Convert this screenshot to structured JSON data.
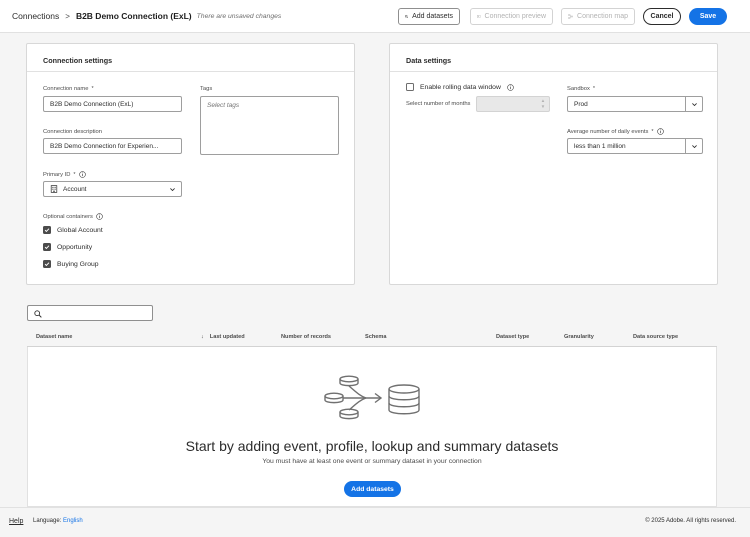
{
  "header": {
    "breadcrumb_root": "Connections",
    "breadcrumb_separator": ">",
    "breadcrumb_current": "B2B Demo Connection (ExL)",
    "unsaved_note": "There are unsaved changes",
    "add_datasets_label": "Add datasets",
    "connection_preview_label": "Connection preview",
    "connection_map_label": "Connection map",
    "cancel_label": "Cancel",
    "save_label": "Save"
  },
  "connection_settings": {
    "title": "Connection settings",
    "name_label": "Connection name",
    "name_value": "B2B Demo Connection (ExL)",
    "tags_label": "Tags",
    "tags_placeholder": "Select tags",
    "description_label": "Connection description",
    "description_value": "B2B Demo Connection for Experien...",
    "primary_id_label": "Primary ID",
    "primary_id_value": "Account",
    "optional_containers_label": "Optional containers",
    "containers": [
      {
        "label": "Global Account",
        "checked": true
      },
      {
        "label": "Opportunity",
        "checked": true
      },
      {
        "label": "Buying Group",
        "checked": true
      }
    ]
  },
  "data_settings": {
    "title": "Data settings",
    "rolling_window_label": "Enable rolling data window",
    "rolling_window_checked": false,
    "months_label": "Select number of months",
    "sandbox_label": "Sandbox",
    "sandbox_value": "Prod",
    "daily_events_label": "Average number of daily events",
    "daily_events_value": "less than 1 million"
  },
  "required_marker": "*",
  "table": {
    "columns": [
      "Dataset name",
      "Last updated",
      "Number of records",
      "Schema",
      "Dataset type",
      "Granularity",
      "Data source type"
    ],
    "sort_indicator": "↓"
  },
  "empty_state": {
    "title": "Start by adding event, profile, lookup and summary datasets",
    "subtitle": "You must have at least one event or summary dataset in your connection",
    "button_label": "Add datasets"
  },
  "footer": {
    "help": "Help",
    "language_label": "Language:",
    "language_value": "English",
    "copyright": "© 2025 Adobe. All rights reserved."
  },
  "colors": {
    "accent": "#1473e6",
    "text": "#2c2c2c",
    "background": "#f5f5f5"
  }
}
